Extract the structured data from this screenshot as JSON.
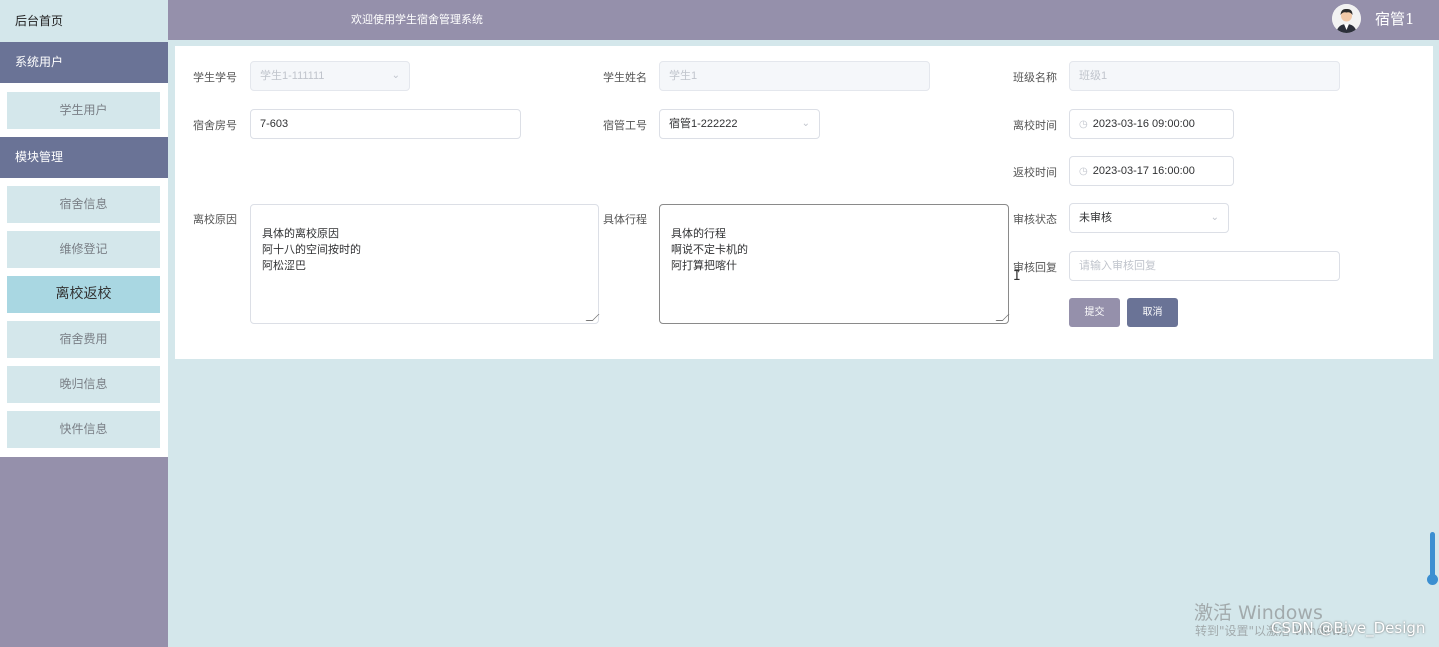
{
  "sidebar": {
    "home": "后台首页",
    "groups": [
      {
        "title": "系统用户",
        "items": [
          "学生用户"
        ]
      },
      {
        "title": "模块管理",
        "items": [
          "宿舍信息",
          "维修登记",
          "离校返校",
          "宿舍费用",
          "晚归信息",
          "快件信息"
        ]
      }
    ],
    "active_item": "离校返校"
  },
  "header": {
    "title": "欢迎使用学生宿舍管理系统",
    "user_name": "宿管1"
  },
  "form": {
    "student_id": {
      "label": "学生学号",
      "value": "学生1-111111"
    },
    "student_name": {
      "label": "学生姓名",
      "value": "学生1"
    },
    "class_name": {
      "label": "班级名称",
      "value": "班级1"
    },
    "room_no": {
      "label": "宿舍房号",
      "value": "7-603"
    },
    "manager_id": {
      "label": "宿管工号",
      "value": "宿管1-222222"
    },
    "leave_time": {
      "label": "离校时间",
      "value": "2023-03-16 09:00:00"
    },
    "return_time": {
      "label": "返校时间",
      "value": "2023-03-17 16:00:00"
    },
    "leave_reason": {
      "label": "离校原因",
      "value": "具体的离校原因\n阿十八的空间按时的\n阿松涩巴"
    },
    "itinerary": {
      "label": "具体行程",
      "value": "具体的行程\n啊说不定卡机的\n阿打算把喀什"
    },
    "review_status": {
      "label": "审核状态",
      "value": "未审核"
    },
    "review_reply": {
      "label": "审核回复",
      "placeholder": "请输入审核回复"
    },
    "submit": "提交",
    "cancel": "取消"
  },
  "watermark": {
    "line1": "激活 Windows",
    "line2": "转到\"设置\"以激活 Windows。",
    "csdn": "CSDN @Biye_Design"
  },
  "colors": {
    "header": "#9590ab",
    "group": "#6a7396",
    "background": "#d4e7eb",
    "active_item": "#a9d7e2",
    "scrollbar": "#3b8fd1"
  }
}
